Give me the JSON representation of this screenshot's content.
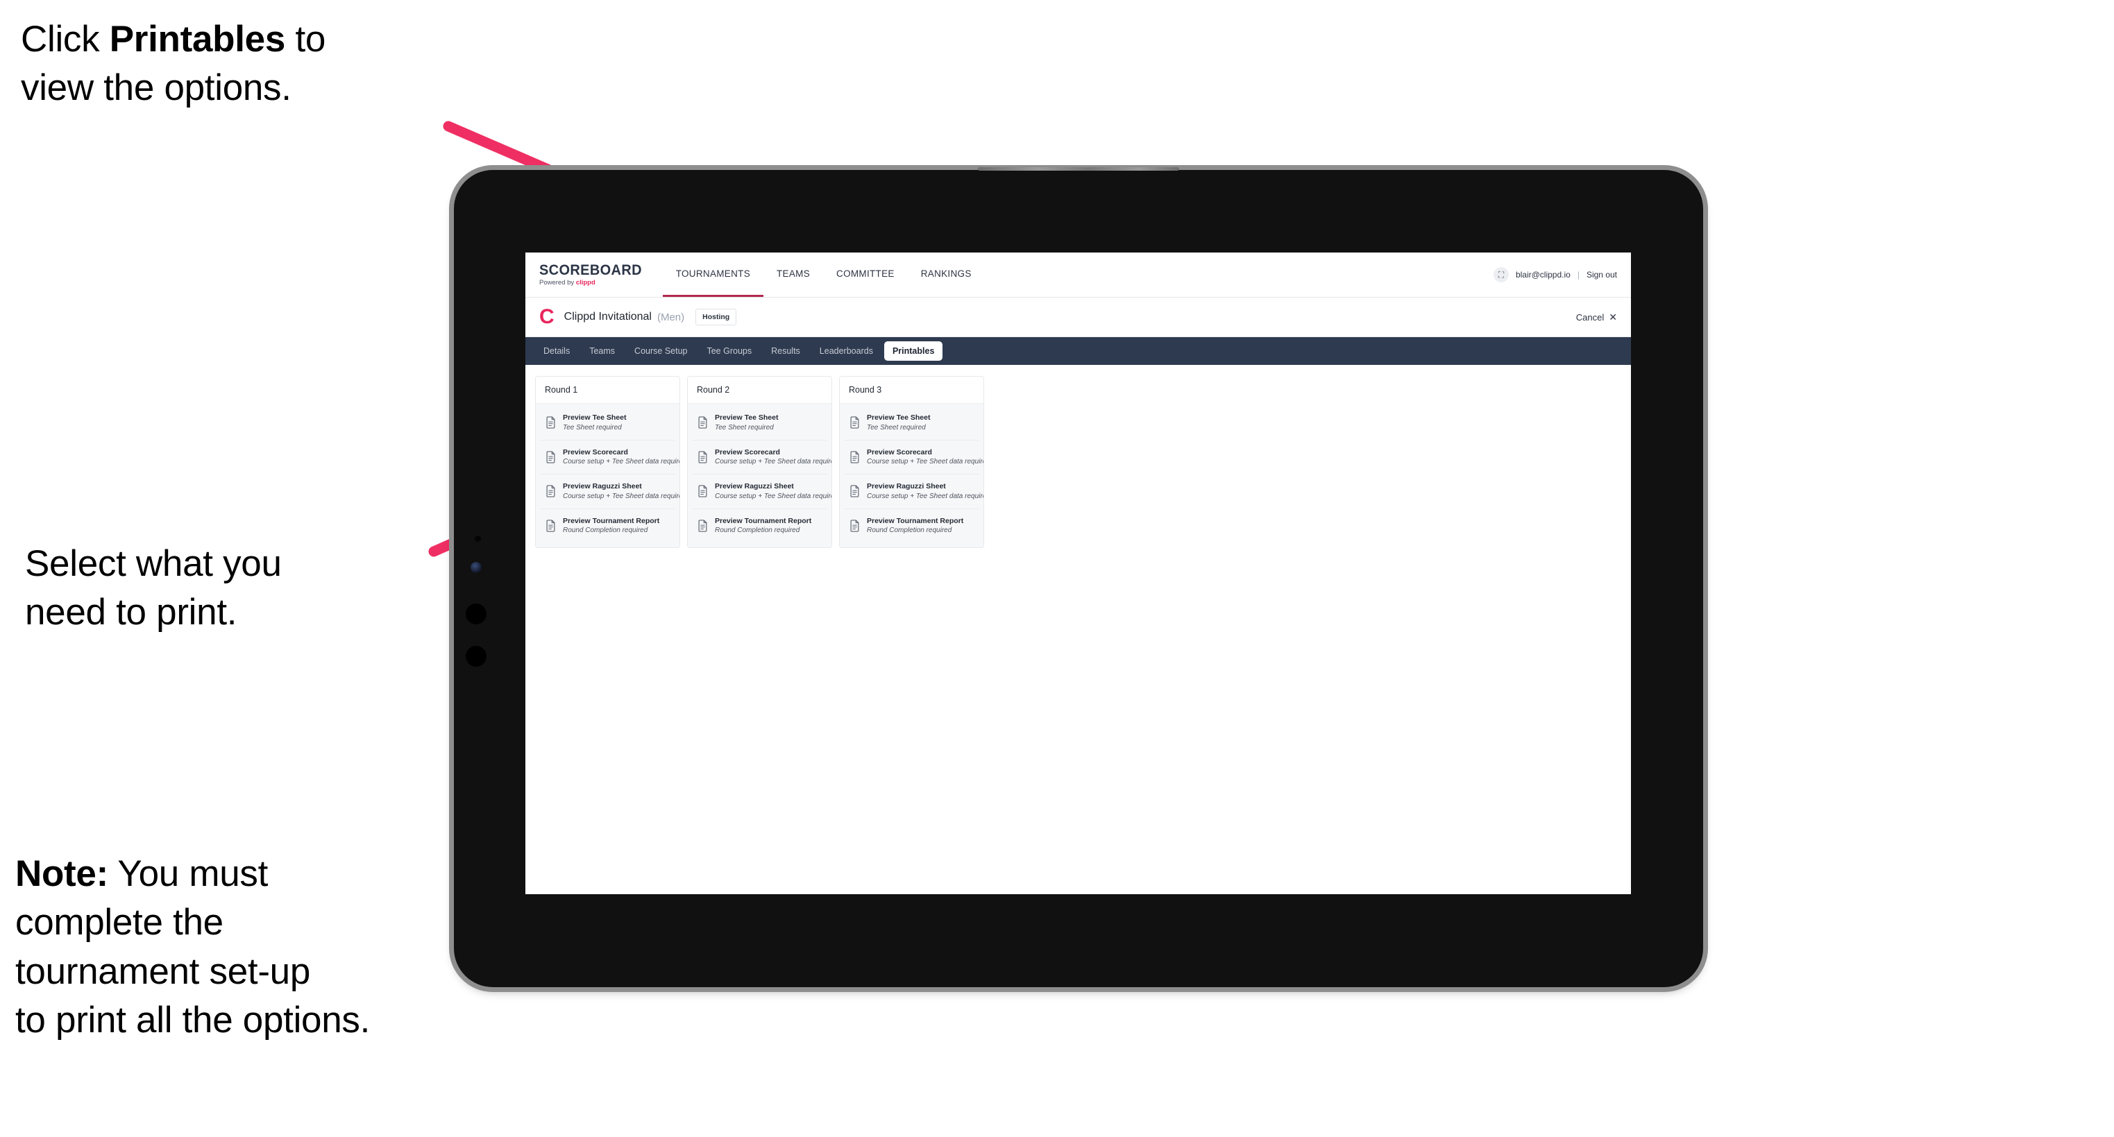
{
  "annotations": {
    "click_printables": {
      "prefix": "Click ",
      "bold": "Printables",
      "suffix": " to\nview the options."
    },
    "select_print": "Select what you\n need to print.",
    "note": {
      "bold": "Note:",
      "rest": " You must\ncomplete the\ntournament set-up\nto print all the options."
    }
  },
  "app": {
    "header": {
      "logo_wordmark": "SCOREBOARD",
      "logo_sub_prefix": "Powered by ",
      "logo_sub_brand": "clippd",
      "nav": [
        {
          "label": "TOURNAMENTS",
          "active": true
        },
        {
          "label": "TEAMS",
          "active": false
        },
        {
          "label": "COMMITTEE",
          "active": false
        },
        {
          "label": "RANKINGS",
          "active": false
        }
      ],
      "user_email": "blair@clippd.io",
      "user_separator": "|",
      "sign_out_label": "Sign out",
      "avatar_glyph": "⛶"
    },
    "title_bar": {
      "clippd_mark": "C",
      "tournament_name": "Clippd Invitational",
      "gender": "(Men)",
      "hosting_badge": "Hosting",
      "cancel_label": "Cancel",
      "cancel_icon": "✕"
    },
    "tabs": [
      {
        "label": "Details",
        "active": false
      },
      {
        "label": "Teams",
        "active": false
      },
      {
        "label": "Course Setup",
        "active": false
      },
      {
        "label": "Tee Groups",
        "active": false
      },
      {
        "label": "Results",
        "active": false
      },
      {
        "label": "Leaderboards",
        "active": false
      },
      {
        "label": "Printables",
        "active": true
      }
    ],
    "rounds": [
      {
        "title": "Round 1",
        "items": [
          {
            "title": "Preview Tee Sheet",
            "sub": "Tee Sheet required"
          },
          {
            "title": "Preview Scorecard",
            "sub": "Course setup + Tee Sheet data required"
          },
          {
            "title": "Preview Raguzzi Sheet",
            "sub": "Course setup + Tee Sheet data required"
          },
          {
            "title": "Preview Tournament Report",
            "sub": "Round Completion required"
          }
        ]
      },
      {
        "title": "Round 2",
        "items": [
          {
            "title": "Preview Tee Sheet",
            "sub": "Tee Sheet required"
          },
          {
            "title": "Preview Scorecard",
            "sub": "Course setup + Tee Sheet data required"
          },
          {
            "title": "Preview Raguzzi Sheet",
            "sub": "Course setup + Tee Sheet data required"
          },
          {
            "title": "Preview Tournament Report",
            "sub": "Round Completion required"
          }
        ]
      },
      {
        "title": "Round 3",
        "items": [
          {
            "title": "Preview Tee Sheet",
            "sub": "Tee Sheet required"
          },
          {
            "title": "Preview Scorecard",
            "sub": "Course setup + Tee Sheet data required"
          },
          {
            "title": "Preview Raguzzi Sheet",
            "sub": "Course setup + Tee Sheet data required"
          },
          {
            "title": "Preview Tournament Report",
            "sub": "Round Completion required"
          }
        ]
      }
    ]
  },
  "colors": {
    "accent_pink": "#ef2f63",
    "brand_pink": "#e8275d",
    "tab_bar_navy": "#2e3a4f",
    "nav_underline": "#b32a4e",
    "card_body_gray": "#f6f7f8"
  }
}
